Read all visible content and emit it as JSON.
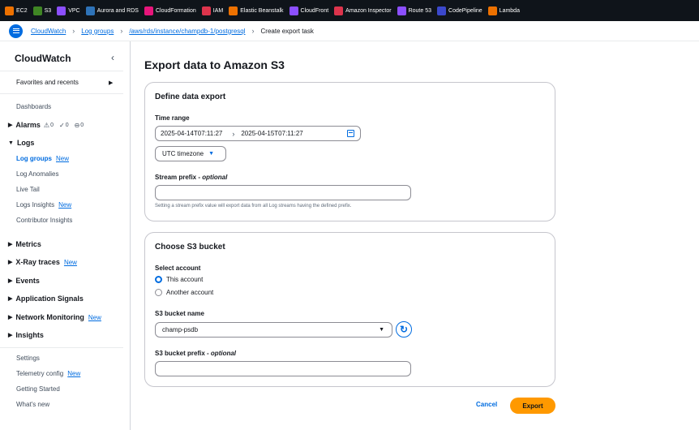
{
  "topbar": {
    "services": [
      {
        "label": "EC2",
        "color": "#ed7100",
        "icon": "ec2-icon"
      },
      {
        "label": "S3",
        "color": "#3f8624",
        "icon": "s3-icon"
      },
      {
        "label": "VPC",
        "color": "#8c4fff",
        "icon": "vpc-icon"
      },
      {
        "label": "Aurora and RDS",
        "color": "#2e73b8",
        "icon": "rds-icon"
      },
      {
        "label": "CloudFormation",
        "color": "#e7157b",
        "icon": "cloudformation-icon"
      },
      {
        "label": "IAM",
        "color": "#dd344c",
        "icon": "iam-icon"
      },
      {
        "label": "Elastic Beanstalk",
        "color": "#ed7100",
        "icon": "beanstalk-icon"
      },
      {
        "label": "CloudFront",
        "color": "#8c4fff",
        "icon": "cloudfront-icon"
      },
      {
        "label": "Amazon Inspector",
        "color": "#dd344c",
        "icon": "inspector-icon"
      },
      {
        "label": "Route 53",
        "color": "#8c4fff",
        "icon": "route53-icon"
      },
      {
        "label": "CodePipeline",
        "color": "#3b48cc",
        "icon": "codepipeline-icon"
      },
      {
        "label": "Lambda",
        "color": "#ed7100",
        "icon": "lambda-icon"
      }
    ]
  },
  "breadcrumb": {
    "items": [
      "CloudWatch",
      "Log groups",
      "/aws/rds/instance/champdb-1/postgresql"
    ],
    "current": "Create export task"
  },
  "sidebar": {
    "title": "CloudWatch",
    "favorites": "Favorites and recents",
    "dashboards": "Dashboards",
    "alarms": {
      "label": "Alarms",
      "counts": [
        "0",
        "0",
        "0"
      ]
    },
    "logs": {
      "label": "Logs",
      "items": [
        {
          "label": "Log groups",
          "new": "New"
        },
        {
          "label": "Log Anomalies",
          "new": ""
        },
        {
          "label": "Live Tail",
          "new": ""
        },
        {
          "label": "Logs Insights",
          "new": "New"
        },
        {
          "label": "Contributor Insights",
          "new": ""
        }
      ]
    },
    "sections": [
      {
        "label": "Metrics",
        "new": ""
      },
      {
        "label": "X-Ray traces",
        "new": "New"
      },
      {
        "label": "Events",
        "new": ""
      },
      {
        "label": "Application Signals",
        "new": ""
      },
      {
        "label": "Network Monitoring",
        "new": "New"
      },
      {
        "label": "Insights",
        "new": ""
      }
    ],
    "footer": [
      {
        "label": "Settings",
        "new": ""
      },
      {
        "label": "Telemetry config",
        "new": "New"
      },
      {
        "label": "Getting Started",
        "new": ""
      },
      {
        "label": "What's new",
        "new": ""
      }
    ]
  },
  "main": {
    "title": "Export data to Amazon S3",
    "define": {
      "heading": "Define data export",
      "time_range_label": "Time range",
      "start": "2025-04-14T07:11:27",
      "end": "2025-04-15T07:11:27",
      "timezone": "UTC timezone",
      "prefix_label": "Stream prefix",
      "prefix_optional": "optional",
      "prefix_value": "",
      "prefix_hint": "Setting a stream prefix value will export data from all Log streams having the defined prefix."
    },
    "bucket": {
      "heading": "Choose S3 bucket",
      "account_label": "Select account",
      "account_options": [
        "This account",
        "Another account"
      ],
      "selected_account": "This account",
      "bucket_label": "S3 bucket name",
      "bucket_value": "champ-psdb",
      "bucket_prefix_label": "S3 bucket prefix",
      "bucket_prefix_optional": "optional",
      "bucket_prefix_value": ""
    },
    "actions": {
      "cancel": "Cancel",
      "export": "Export"
    }
  },
  "colors": {
    "accent": "#006ce0",
    "primary_button": "#ff9900",
    "topbar": "#0f141a"
  }
}
